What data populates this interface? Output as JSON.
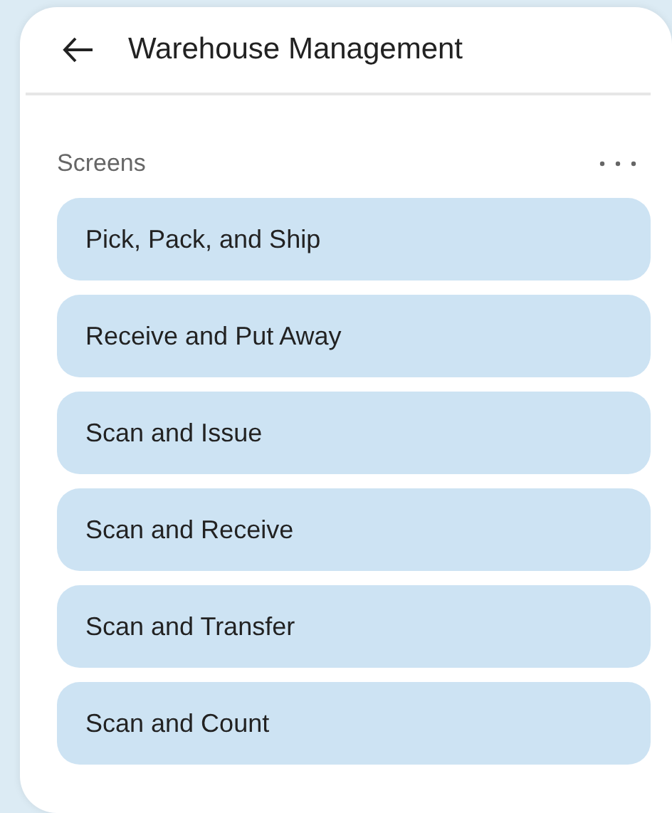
{
  "header": {
    "title": "Warehouse Management"
  },
  "section": {
    "title": "Screens"
  },
  "items": [
    {
      "label": "Pick, Pack, and Ship"
    },
    {
      "label": "Receive and Put Away"
    },
    {
      "label": "Scan and Issue"
    },
    {
      "label": "Scan and Receive"
    },
    {
      "label": "Scan and Transfer"
    },
    {
      "label": "Scan and Count"
    }
  ]
}
